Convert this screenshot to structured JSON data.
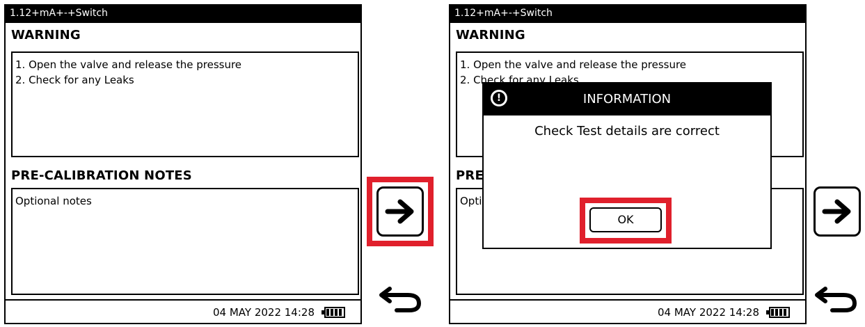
{
  "left_screen": {
    "title": "1.12+mA+-+Switch",
    "warning_heading": "WARNING",
    "warning_lines": [
      "1. Open the valve and release the pressure",
      "2. Check for any Leaks"
    ],
    "notes_heading": "PRE-CALIBRATION NOTES",
    "notes_text": "Optional notes",
    "datetime": "04 MAY 2022 14:28"
  },
  "right_screen": {
    "title": "1.12+mA+-+Switch",
    "warning_heading": "WARNING",
    "warning_lines": [
      "1. Open the valve and release the pressure",
      "2. Check for any Leaks"
    ],
    "notes_heading": "PRE",
    "notes_text": "Opti",
    "datetime": "04 MAY 2022 14:28",
    "dialog": {
      "title": "INFORMATION",
      "icon": "exclamation-circle-icon",
      "message": "Check Test details are correct",
      "ok_label": "OK"
    }
  },
  "icons": {
    "next": "arrow-right-icon",
    "back": "return-arrow-icon",
    "battery": "battery-full-icon"
  },
  "colors": {
    "highlight": "#e0202c",
    "title_bar": "#000000"
  }
}
